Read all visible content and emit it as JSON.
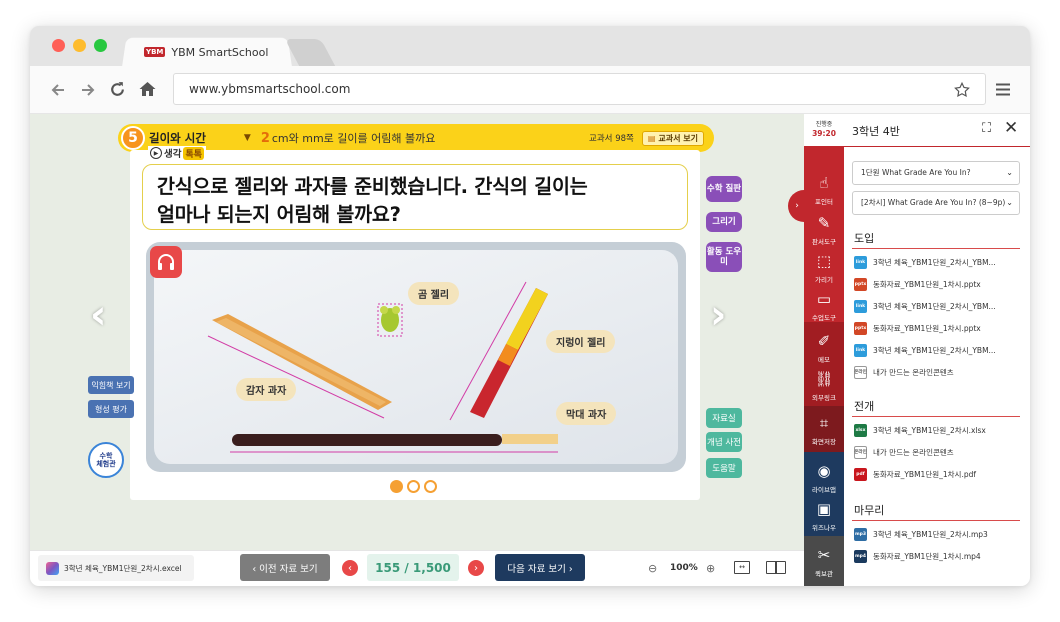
{
  "browser": {
    "tab_title": "YBM SmartSchool",
    "logo_text": "YBM",
    "close_glyph": "×",
    "url": "www.ybmsmartschool.com",
    "icons": [
      "back-arrow-icon",
      "forward-arrow-icon",
      "reload-icon",
      "home-icon",
      "star-icon",
      "menu-icon"
    ]
  },
  "lesson": {
    "unit_number": "5",
    "unit_title": "길이와 시간",
    "sub_number": "2",
    "sub_title": "cm와 mm로 길이를 어림해 볼까요",
    "page_ref": "교과서  98쪽",
    "textbook_button": "교과서 보기",
    "think_label": "생각",
    "think_badge": "톡톡",
    "question_line1": "간식으로 젤리와 과자를 준비했습니다. 간식의 길이는",
    "question_line2": "얼마나 되는지 어림해 볼까요?",
    "labels": {
      "bear": "곰 젤리",
      "potato": "감자 과자",
      "worm": "지렁이 젤리",
      "stick": "막대 과자"
    },
    "right_tools": [
      "수학 질판",
      "그리기",
      "활동 도우미"
    ],
    "left_tools": [
      "익힘책 보기",
      "형성 평가"
    ],
    "math_badge": [
      "수학",
      "체험관"
    ],
    "teal_tools": [
      "자료실",
      "개념 사전",
      "도움말"
    ],
    "slide_dots": 3,
    "active_dot": 0
  },
  "bottombar": {
    "file_name": "3학년 체육_YBM1단원_2차시.excel",
    "prev_button": "‹ 이전 자료 보기",
    "page_counter": "155 / 1,500",
    "next_button": "다음 자료 보기 ›",
    "zoom": "100%"
  },
  "sidebar": {
    "timer_label": "진행중",
    "timer_value": "39:20",
    "items": [
      "포인터",
      "판서도구",
      "가리기",
      "수업도구",
      "메모",
      "외부링크",
      "화면저장",
      "라이브앱",
      "위즈나우",
      "퀵보관"
    ]
  },
  "panel": {
    "class_title": "3학년 4반",
    "unit_select": "1단원 What Grade Are You In?",
    "lesson_select": "[2차시] What Grade Are You In? (8~9p)",
    "sections": [
      {
        "title": "도입",
        "items": [
          {
            "type": "link",
            "name": "3학년 체육_YBM1단원_2차시_YBM..."
          },
          {
            "type": "pptx",
            "name": "동화자료_YBM1단원_1차시.pptx"
          },
          {
            "type": "link",
            "name": "3학년 체육_YBM1단원_2차시_YBM..."
          },
          {
            "type": "pptx",
            "name": "동화자료_YBM1단원_1차시.pptx"
          },
          {
            "type": "link",
            "name": "3학년 체육_YBM1단원_2차시_YBM..."
          },
          {
            "type": "mine",
            "name": "내가 만드는 온라인콘텐츠"
          }
        ]
      },
      {
        "title": "전개",
        "items": [
          {
            "type": "xlsx",
            "name": "3학년 체육_YBM1단원_2차시.xlsx"
          },
          {
            "type": "mine",
            "name": "내가 만드는 온라인콘텐츠"
          },
          {
            "type": "pdf",
            "name": "동화자료_YBM1단원_1차시.pdf"
          }
        ]
      },
      {
        "title": "마무리",
        "items": [
          {
            "type": "mp3",
            "name": "3학년 체육_YBM1단원_2차시.mp3"
          },
          {
            "type": "mp4",
            "name": "동화자료_YBM1단원_1차시.mp4"
          }
        ]
      }
    ],
    "file_badges": {
      "link": "link",
      "pptx": "pptx",
      "xlsx": "xlsx",
      "pdf": "pdf",
      "mp3": "mp3",
      "mp4": "mp4",
      "mine": "온라인"
    },
    "file_colors": {
      "link": "#2d9cdb",
      "pptx": "#d24726",
      "xlsx": "#1e7a45",
      "pdf": "#c8161d",
      "mp3": "#2e6da4",
      "mp4": "#1b3a5e",
      "mine": "#ffffff"
    }
  },
  "colors": {
    "banner": "#fbd219",
    "accent_red": "#c1272d",
    "purple": "#8a4fb8",
    "teal": "#4eb89e",
    "navy": "#1e3a5f"
  }
}
